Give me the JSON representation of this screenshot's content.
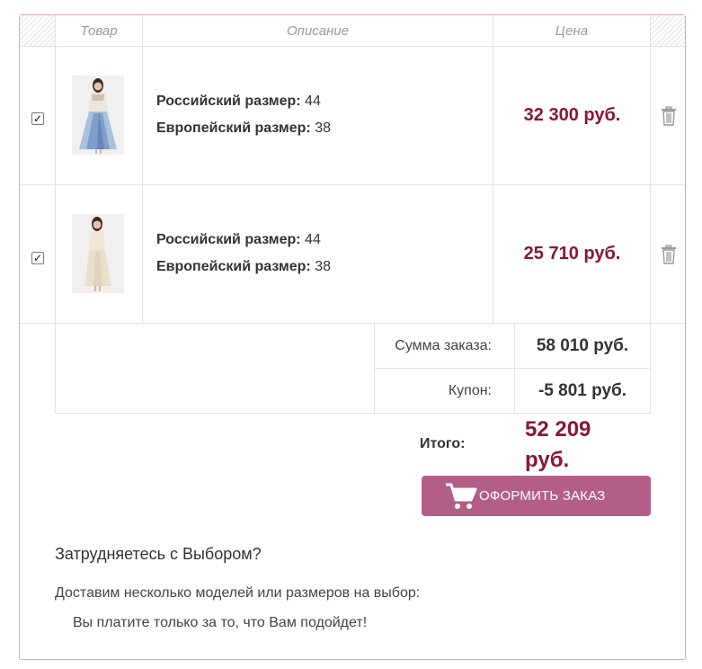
{
  "table": {
    "headers": {
      "product": "Товар",
      "description": "Описание",
      "price": "Цена"
    }
  },
  "items": [
    {
      "checked": true,
      "ru_size_label": "Российский размер:",
      "ru_size_value": "44",
      "eu_size_label": "Европейский размер:",
      "eu_size_value": "38",
      "price": "32 300 руб."
    },
    {
      "checked": true,
      "ru_size_label": "Российский размер:",
      "ru_size_value": "44",
      "eu_size_label": "Европейский размер:",
      "eu_size_value": "38",
      "price": "25 710 руб."
    }
  ],
  "summary": {
    "order_sum_label": "Сумма заказа:",
    "order_sum_value": "58 010 руб.",
    "coupon_label": "Купон:",
    "coupon_value": "-5 801 руб.",
    "total_label": "Итого:",
    "total_value": "52 209 руб."
  },
  "checkout": {
    "button_label": "ОФОРМИТЬ ЗАКАЗ"
  },
  "help": {
    "title": "Затрудняетесь с Выбором?",
    "line1": "Доставим несколько моделей или размеров на выбор:",
    "line2": "Вы платите только за то, что Вам подойдет!"
  },
  "icons": {
    "checkbox": "check-icon",
    "delete": "trash-icon",
    "cart": "cart-icon"
  },
  "colors": {
    "accent": "#8a1538",
    "button": "#b35e87",
    "border": "#d7a9b5"
  }
}
